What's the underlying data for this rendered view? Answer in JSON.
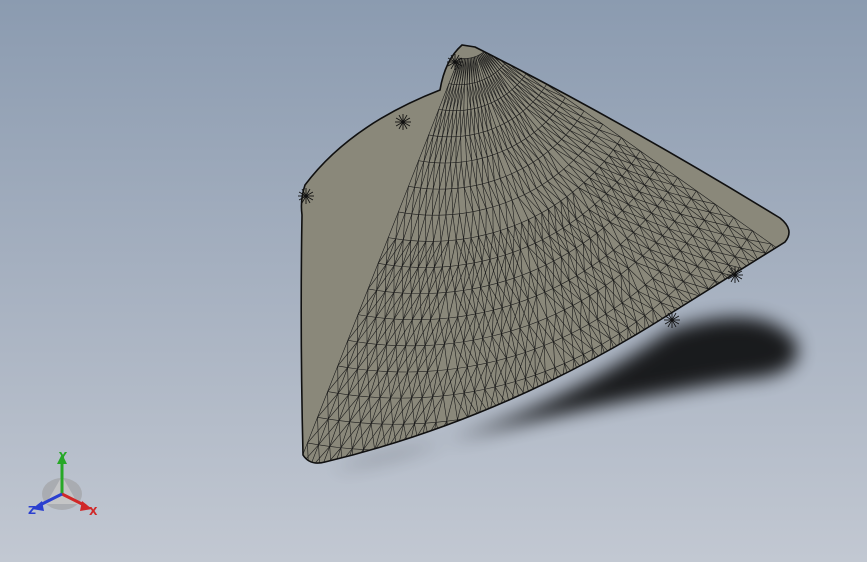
{
  "viewport": {
    "background_top": "#8b9bb0",
    "background_bottom": "#c2c8d2"
  },
  "model": {
    "shape": "meshed curved sector surface",
    "face_color": "#8a887a",
    "mesh_line_color": "#1a1a1a"
  },
  "triad": {
    "x_label": "X",
    "y_label": "Y",
    "z_label": "Z",
    "x_color": "#d02828",
    "y_color": "#27a827",
    "z_color": "#2a3fd0"
  }
}
